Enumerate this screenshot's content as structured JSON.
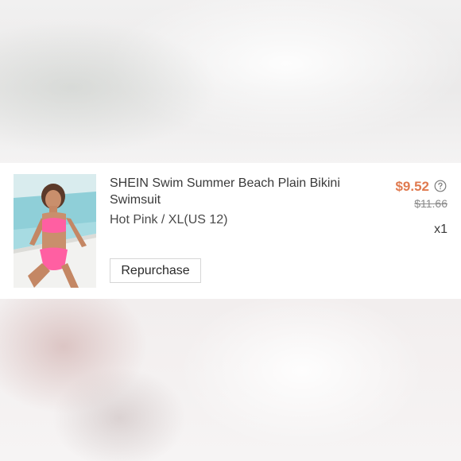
{
  "order_item": {
    "title": "SHEIN Swim Summer Beach Plain Bikini Swimsuit",
    "variant": "Hot Pink / XL(US 12)",
    "price": "$9.52",
    "original_price": "$11.66",
    "quantity": "x1",
    "repurchase_label": "Repurchase",
    "help_icon": "question-circle-icon",
    "image_icon": "product-photo"
  },
  "colors": {
    "price": "#e07a4f",
    "text": "#3a3a3a",
    "muted": "#8a8a8a",
    "button_border": "#d6d6d6",
    "product_color": "#ff5fa2"
  }
}
